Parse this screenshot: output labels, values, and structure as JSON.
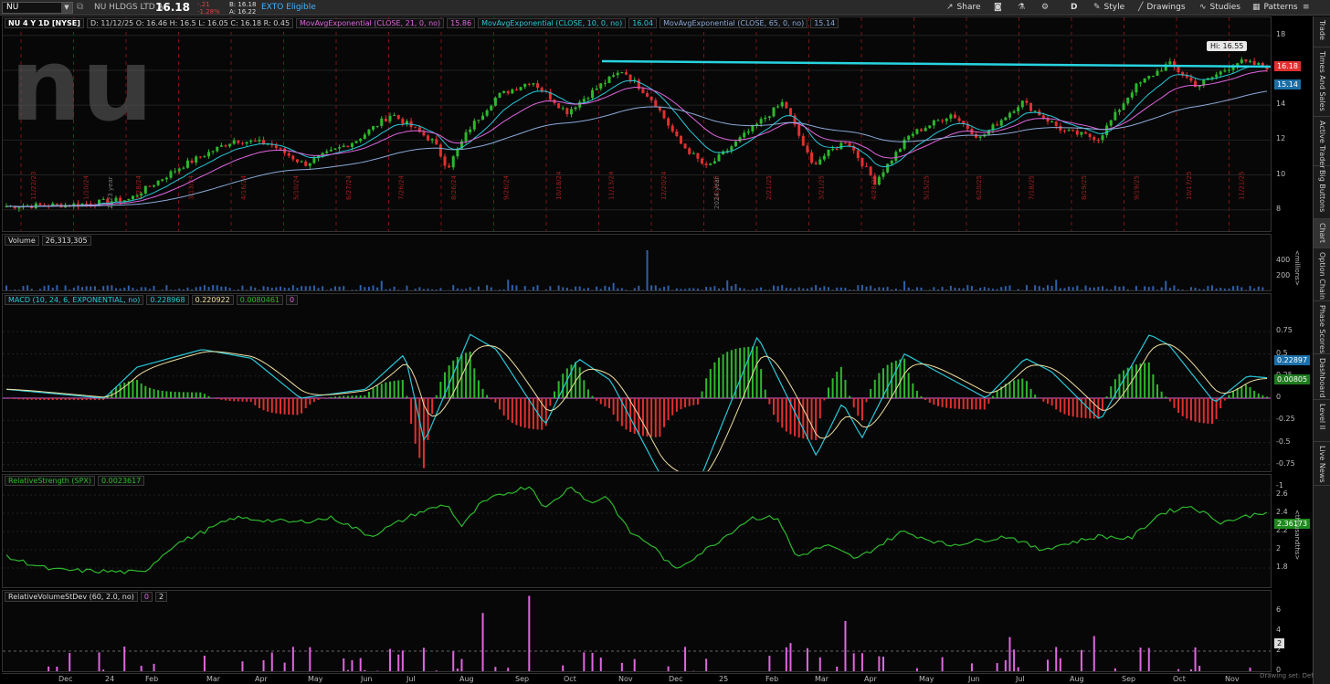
{
  "toolbar": {
    "symbol": "NU",
    "company_name": "NU HLDGS LTD A",
    "last_price": "16.18",
    "net_change": "-.21",
    "net_change_pct": "-1.28%",
    "bid": "B: 16.18",
    "ask": "A: 16.22",
    "exto": "EXTO Eligible",
    "share_label": "Share",
    "period_label": "D",
    "style_label": "Style",
    "drawings_label": "Drawings",
    "studies_label": "Studies",
    "patterns_label": "Patterns"
  },
  "price_panel": {
    "header": {
      "title": "NU 4 Y 1D [NYSE]",
      "ohlc": "D: 11/12/25   O: 16.46   H: 16.5   L: 16.05   C: 16.18   R: 0.45",
      "ema21": "MovAvgExponential (CLOSE, 21, 0, no)",
      "ema21_val": "15.86",
      "ema10": "MovAvgExponential (CLOSE, 10, 0, no)",
      "ema10_val": "16.04",
      "ema65": "MovAvgExponential (CLOSE, 65, 0, no)",
      "ema65_val": "15.14"
    },
    "logo_text": "nu",
    "hi_label": "Hi: 16.55",
    "price_flag": "16.18",
    "ema65_flag": "15.14",
    "axis_labels": [
      "18",
      "16",
      "14",
      "12",
      "10",
      "8"
    ],
    "year_markers": [
      "2023 year",
      "2024 year"
    ],
    "rotated_dates": [
      "11/22/23",
      "1/10/24",
      "2/28/24",
      "3/13/24",
      "4/16/24",
      "5/10/24",
      "6/27/24",
      "7/26/24",
      "8/26/24",
      "9/26/24",
      "10/18/24",
      "11/13/24",
      "12/20/24",
      "1/17/25",
      "2/21/25",
      "3/21/25",
      "4/28/25",
      "5/15/25",
      "6/20/25",
      "7/18/25",
      "8/19/25",
      "9/19/25",
      "10/17/25",
      "11/21/25"
    ],
    "colors": {
      "up": "#2db82d",
      "down": "#e03030",
      "ema21": "#e066e0",
      "ema10": "#28c8d8",
      "ema65": "#8aaad8",
      "trendline": "#27d3e0"
    }
  },
  "volume_panel": {
    "header": {
      "title": "Volume",
      "value": "26,313,305"
    },
    "axis_labels": [
      "400",
      "200"
    ],
    "unit": "<millions>"
  },
  "macd_panel": {
    "header": {
      "title": "MACD (10, 24, 6, EXPONENTIAL, no)",
      "value": "0.228968",
      "avg": "0.220922",
      "diff": "0.0080461",
      "zero": "0"
    },
    "axis_labels": [
      "0.75",
      "0.5",
      "0.25",
      "0",
      "-0.25",
      "-0.5",
      "-0.75",
      "-1"
    ],
    "value_flag": "0.22897",
    "diff_flag": "0.00805"
  },
  "rs_panel": {
    "header": {
      "title": "RelativeStrength (SPX)",
      "value": "0.0023617"
    },
    "axis_labels": [
      "2.6",
      "2.4",
      "2.2",
      "2",
      "1.8"
    ],
    "value_flag": "2.36173",
    "unit": "<thousandths>"
  },
  "rvs_panel": {
    "header": {
      "title": "RelativeVolumeStDev (60, 2.0, no)",
      "value": "0",
      "threshold": "2"
    },
    "axis_labels": [
      "6",
      "4",
      "2",
      "0"
    ],
    "value_flag": "2"
  },
  "x_axis": {
    "labels": [
      "Dec",
      "24",
      "Feb",
      "Mar",
      "Apr",
      "May",
      "Jun",
      "Jul",
      "Aug",
      "Sep",
      "Oct",
      "Nov",
      "Dec",
      "25",
      "Feb",
      "Mar",
      "Apr",
      "May",
      "Jun",
      "Jul",
      "Aug",
      "Sep",
      "Oct",
      "Nov"
    ]
  },
  "drawing_set": "Drawing set: Default",
  "sidebar": {
    "tabs": [
      "Trade",
      "Times And Sales",
      "Active Trader",
      "Big Buttons",
      "Chart",
      "Option Chain",
      "Phase Scores",
      "Dashboard",
      "Level II",
      "Live News"
    ]
  }
}
